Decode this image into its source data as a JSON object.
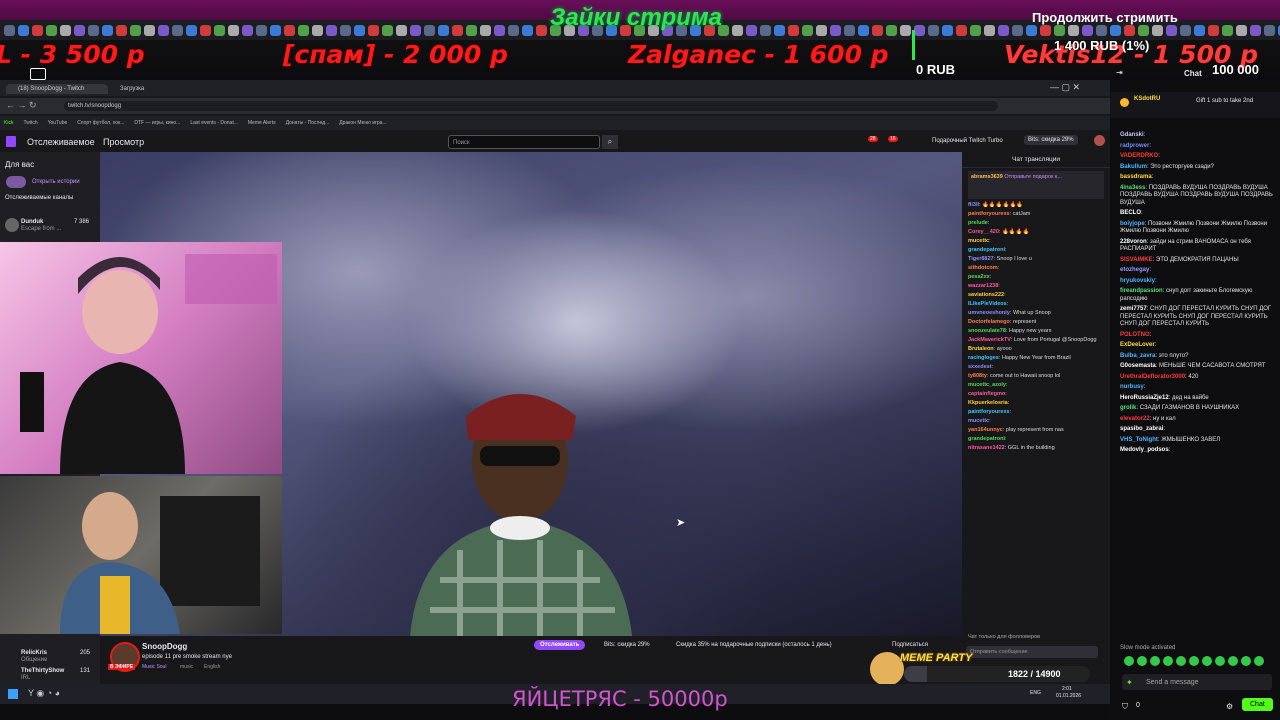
{
  "overlay": {
    "title": "Зайки стрима",
    "continue_label": "Продолжить стримить",
    "rub_percent": "1 400 RUB (1%)",
    "rub_zero": "0 RUB",
    "rub_goal": "100 000 RUB",
    "donations": [
      "L - 3 500 р",
      "[спам] - 2 000 р",
      "Zalganec - 1 600 р",
      "Vektis12 - 1 500 р"
    ],
    "bottom_text": "ЯЙЦЕТРЯС - 50000р"
  },
  "browser": {
    "tabs": [
      "(18) SnoopDogg - Twitch",
      "Загрузка"
    ],
    "url": "twitch.tv/snoopdogg",
    "bookmarks": [
      "Kick",
      "Twitch",
      "YouTube",
      "Спорт футбол, хок...",
      "DTF — игры, кино...",
      "Last events - Donat...",
      "Meme Alerts",
      "Донаты - Послед...",
      "Дракон Меню игра..."
    ]
  },
  "twitch": {
    "nav": {
      "following": "Отслеживаемое",
      "browse": "Просмотр",
      "search_placeholder": "Поиск",
      "turbo": "Подарочный Twitch Turbo",
      "bits_sale": "Bits: скидка 29%",
      "notif1": "28",
      "notif2": "16"
    },
    "sidebar": {
      "title": "Для вас",
      "history": "Открыть истории",
      "followed": "Отслеживаемые каналы",
      "items": [
        {
          "name": "Dunduk",
          "sub": "Escape from ...",
          "viewers": "7 386"
        },
        {
          "name": "RelicKris",
          "sub": "Общение",
          "viewers": "205"
        },
        {
          "name": "TheThirtyShow",
          "sub": "IRL",
          "viewers": "131"
        }
      ]
    },
    "channel": {
      "name": "SnoopDogg",
      "title": "episode 11 pre smoke stream nye",
      "tags": [
        "Music Soul",
        "music",
        "English"
      ],
      "live": "В ЭФИРЕ",
      "follow": "Отслеживать",
      "bits": "Bits: скидка 29%",
      "gift": "Скидка 35% на подарочные подписки (осталось 1 день)",
      "subscribe": "Подписаться"
    },
    "chat": {
      "title": "Чат трансляции",
      "pinned_user": "abrams3639",
      "pinned_text": "Отправьте подарок к...",
      "messages": [
        {
          "user": "fli3ll",
          "text": "🔥🔥🔥🔥🔥🔥"
        },
        {
          "user": "paintforyourexs",
          "text": "catJam"
        },
        {
          "user": "prelude",
          "text": ""
        },
        {
          "user": "Corey__420",
          "text": "🔥🔥🔥🔥"
        },
        {
          "user": "mucettc",
          "text": ""
        },
        {
          "user": "grandepatroni",
          "text": ""
        },
        {
          "user": "Tiger8827",
          "text": "Snoop I love u"
        },
        {
          "user": "sithdotcom",
          "text": ""
        },
        {
          "user": "pesa2xx",
          "text": ""
        },
        {
          "user": "wazzar1238",
          "text": ""
        },
        {
          "user": "saviations222",
          "text": ""
        },
        {
          "user": "ILikePieVideos",
          "text": ""
        },
        {
          "user": "umvneoeshoniy",
          "text": "What up Snoop"
        },
        {
          "user": "Doctorfelamego",
          "text": "represent"
        },
        {
          "user": "snoozeulate78",
          "text": "Happy new years"
        },
        {
          "user": "JackMaverickTV",
          "text": "Love from Portugal @SnoopDogg"
        },
        {
          "user": "Brutaleon",
          "text": "ayooo"
        },
        {
          "user": "racingloges",
          "text": "Happy New Year from Brazil"
        },
        {
          "user": "sxxedest",
          "text": ""
        },
        {
          "user": "ty808ty",
          "text": "come out to Hawaii snoop lol"
        },
        {
          "user": "mucettc_azoly",
          "text": ""
        },
        {
          "user": "captainflegmo",
          "text": ""
        },
        {
          "user": "Kkpuerkelosria",
          "text": ""
        },
        {
          "user": "paintforyourexs",
          "text": ""
        },
        {
          "user": "mucettc",
          "text": ""
        },
        {
          "user": "yan164unnyc",
          "text": "play represent from nas"
        },
        {
          "user": "grandepatroni",
          "text": ""
        },
        {
          "user": "nitrasane1422",
          "text": "GGL in the building"
        }
      ],
      "followers_only": "Чат только для фолловеров",
      "send_placeholder": "Отправить сообщение"
    }
  },
  "meme_party": {
    "label": "MEME PARTY",
    "progress": "1822 / 14900",
    "fraction": 0.122
  },
  "right_chat": {
    "title": "Chat",
    "pinned_user": "KSdotRU",
    "pinned_text": "Gift 1 sub to take 2nd",
    "messages": [
      {
        "user": "Gdanski",
        "text": "",
        "color": "#c8c8ff"
      },
      {
        "user": "radprower",
        "text": "",
        "color": "#6f8cff"
      },
      {
        "user": "VADERDRKO",
        "text": "",
        "color": "#ff3b3b"
      },
      {
        "user": "Bakullum",
        "text": "Это ресторгуев сзади?",
        "color": "#4fb7ff"
      },
      {
        "user": "bassdrama",
        "text": "",
        "color": "#ffdc3a"
      },
      {
        "user": "4ina3ess",
        "text": "ПОЗДРАВЬ ВУДУША ПОЗДРАВЬ ВУДУША ПОЗДРАВЬ ВУДУША ПОЗДРАВЬ ВУДУША ПОЗДРАВЬ ВУДУША",
        "color": "#55e07a"
      },
      {
        "user": "BECLO",
        "text": "",
        "color": "#ffffff"
      },
      {
        "user": "boiyjope",
        "text": "Позвони Жмилю Позвони Жмилю Позвони Жмилю Позвони Жмилю",
        "color": "#4fb7ff"
      },
      {
        "user": "228voron",
        "text": "зайди на стрим ВАНОМАСА он тебя РАСПИАРИТ",
        "color": "#ffffff"
      },
      {
        "user": "SISVAIMKE",
        "text": "ЭТО ДЕМОКРАТИЯ ПАЦАНЫ",
        "color": "#ff3b3b"
      },
      {
        "user": "etozhegay",
        "text": "",
        "color": "#9a9aff"
      },
      {
        "user": "hryukovskiy",
        "text": "",
        "color": "#4fb7ff"
      },
      {
        "user": "fireandpassion",
        "text": "снуп догг закиньте Блогемскую рапсодию",
        "color": "#55e07a"
      },
      {
        "user": "zemi7757",
        "text": "СНУП ДОГ ПЕРЕСТАЛ КУРИТЬ СНУП ДОГ ПЕРЕСТАЛ КУРИТЬ СНУП ДОГ ПЕРЕСТАЛ КУРИТЬ СНУП ДОГ ПЕРЕСТАЛ КУРИТЬ",
        "color": "#ffffff"
      },
      {
        "user": "POLOTNO",
        "text": "",
        "color": "#ff3b3b"
      },
      {
        "user": "ExDeeLover",
        "text": "",
        "color": "#ffdc3a"
      },
      {
        "user": "Bulba_zavra",
        "text": "это плуто?",
        "color": "#4fb7ff"
      },
      {
        "user": "G0osemasta",
        "text": "МЕНЬШЕ ЧЕМ САСАВОТА СМОТРЯТ",
        "color": "#ffffff"
      },
      {
        "user": "UrethralDeflorator3000",
        "text": "420",
        "color": "#ff3b3b"
      },
      {
        "user": "nurbusy",
        "text": "",
        "color": "#4fb7ff"
      },
      {
        "user": "HeroRussiaZje12",
        "text": "дед на вайбе",
        "color": "#ffffff"
      },
      {
        "user": "grolik",
        "text": "СЗАДИ ГАЗМАНОВ В НАУШНИКАХ",
        "color": "#55e07a"
      },
      {
        "user": "elevator22",
        "text": "ну и кал",
        "color": "#ff3b3b"
      },
      {
        "user": "spasibo_zabrai",
        "text": "",
        "color": "#ffffff"
      },
      {
        "user": "VHS_ToNight",
        "text": "ЖМЫШЕНКО ЗАВЕЛ",
        "color": "#4fb7ff"
      },
      {
        "user": "Medovly_podsos",
        "text": "",
        "color": "#ffffff"
      }
    ],
    "slow_mode": "Slow mode activated",
    "send_placeholder": "Send a message",
    "chat_button": "Chat",
    "points": "0"
  },
  "taskbar": {
    "lang": "ENG",
    "time": "2:01",
    "date": "01.01.2026"
  }
}
